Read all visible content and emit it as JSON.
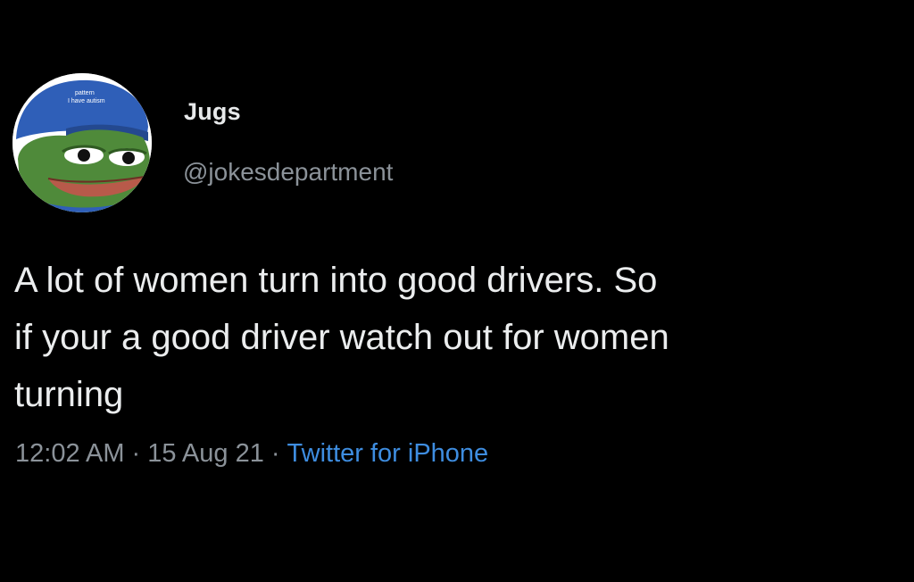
{
  "tweet": {
    "author": {
      "display_name": "Jugs",
      "handle": "@jokesdepartment",
      "avatar_cap_text_1": "pattern",
      "avatar_cap_text_2": "I have autism"
    },
    "text_lines": [
      "A lot of women turn into good drivers. So",
      "if your a good driver watch out for women",
      "turning"
    ],
    "meta": {
      "time": "12:02 AM",
      "separator": "·",
      "date": "15 Aug 21",
      "source": "Twitter for iPhone"
    }
  },
  "colors": {
    "background": "#000000",
    "text_primary": "#e7e9ea",
    "text_secondary": "#8b9299",
    "link": "#3e8de0",
    "avatar_cap": "#2f5fb8",
    "avatar_frog": "#4f8a3a"
  },
  "icons": {
    "avatar": "frog-avatar-icon"
  }
}
